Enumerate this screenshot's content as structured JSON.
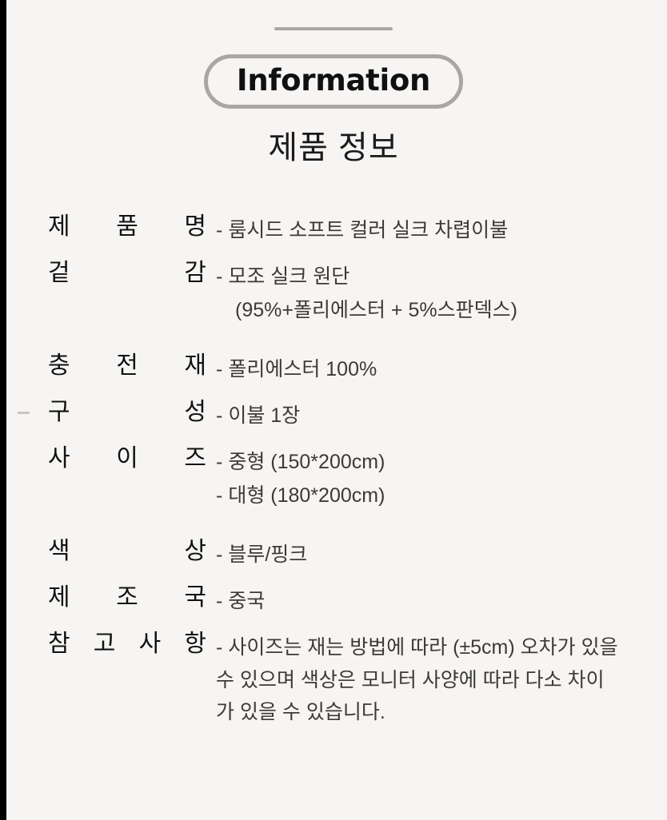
{
  "header": {
    "badge_label": "Information",
    "subtitle": "제품 정보",
    "divider": "horizontal-rule"
  },
  "colors": {
    "background": "#f7f5f3",
    "badge_border": "#a9a6a4",
    "badge_text": "#101010",
    "label_text": "#121212",
    "value_text": "#3c3a39",
    "rule": "#aaa7a5"
  },
  "spec_groups": [
    {
      "rows": [
        {
          "label": "제 품 명",
          "values": [
            {
              "dash": "-",
              "text": "룸시드 소프트 컬러 실크 차렵이불",
              "continuation": false
            }
          ]
        },
        {
          "label": "겉 감",
          "values": [
            {
              "dash": "-",
              "text": "모조 실크 원단",
              "continuation": false
            },
            {
              "dash": "",
              "text": "(95%+폴리에스터 + 5%스판덱스)",
              "continuation": true
            }
          ]
        }
      ]
    },
    {
      "rows": [
        {
          "label": "충 전 재",
          "values": [
            {
              "dash": "-",
              "text": "폴리에스터 100%",
              "continuation": false
            }
          ]
        },
        {
          "label": "구 성",
          "values": [
            {
              "dash": "-",
              "text": "이불 1장",
              "continuation": false
            }
          ]
        },
        {
          "label": "사 이 즈",
          "values": [
            {
              "dash": "-",
              "text": "중형 (150*200cm)",
              "continuation": false
            },
            {
              "dash": "-",
              "text": "대형 (180*200cm)",
              "continuation": false
            }
          ]
        }
      ]
    },
    {
      "rows": [
        {
          "label": "색 상",
          "values": [
            {
              "dash": "-",
              "text": "블루/핑크",
              "continuation": false
            }
          ]
        },
        {
          "label": "제 조 국",
          "values": [
            {
              "dash": "-",
              "text": "중국",
              "continuation": false
            }
          ]
        },
        {
          "label": "참 고 사 항",
          "values": [
            {
              "dash": "-",
              "text": "사이즈는 재는 방법에 따라 (±5cm) 오차가 있을 수 있으며 색상은 모니터 사양에 따라 다소 차이가 있을 수 있습니다.",
              "continuation": false,
              "wrap": true
            }
          ]
        }
      ]
    }
  ]
}
